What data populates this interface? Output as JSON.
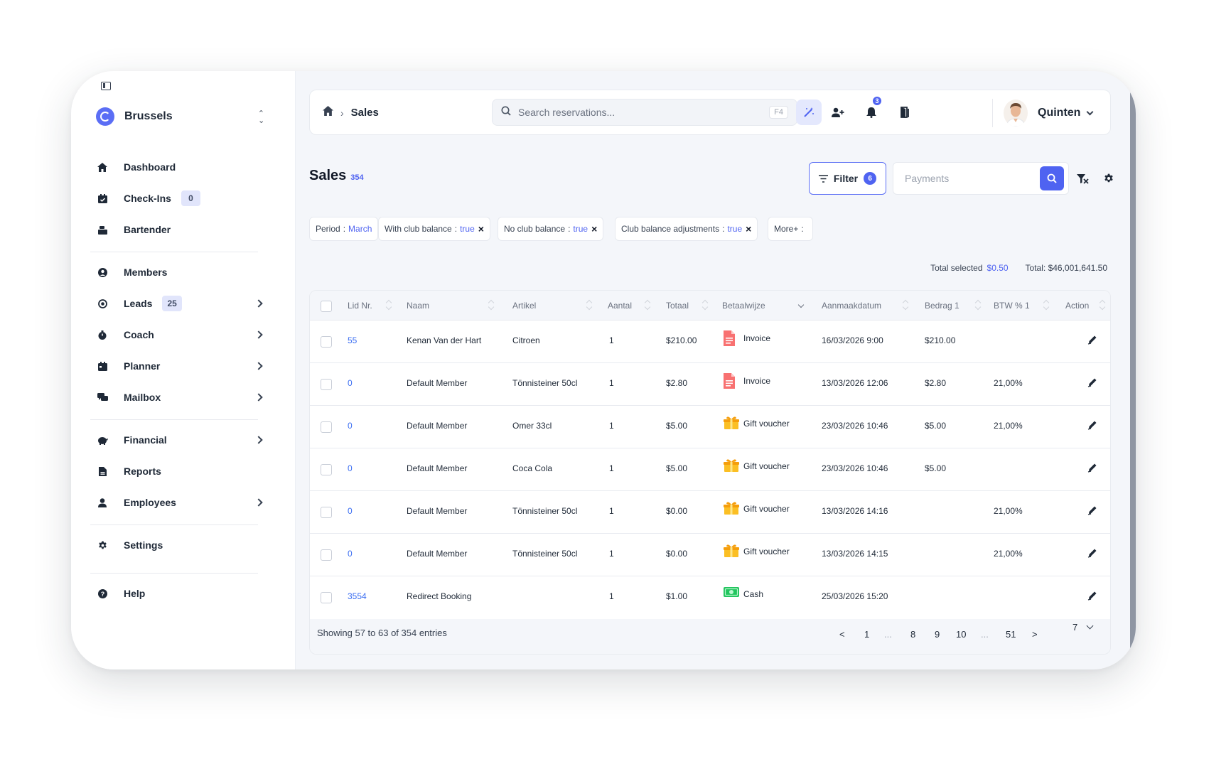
{
  "sidebar": {
    "club": "Brussels",
    "items": [
      {
        "label": "Dashboard",
        "icon": "home-icon"
      },
      {
        "label": "Check-Ins",
        "icon": "check-in-icon",
        "badge": "0"
      },
      {
        "label": "Bartender",
        "icon": "bartender-icon"
      },
      {
        "label": "Members",
        "icon": "user-circle-icon"
      },
      {
        "label": "Leads",
        "icon": "target-icon",
        "badge": "25"
      },
      {
        "label": "Coach",
        "icon": "stopwatch-icon"
      },
      {
        "label": "Planner",
        "icon": "calendar-icon"
      },
      {
        "label": "Mailbox",
        "icon": "chat-icon"
      },
      {
        "label": "Financial",
        "icon": "piggy-bank-icon"
      },
      {
        "label": "Reports",
        "icon": "document-icon"
      },
      {
        "label": "Employees",
        "icon": "user-icon"
      },
      {
        "label": "Settings",
        "icon": "gear-icon"
      },
      {
        "label": "Help",
        "icon": "help-icon"
      }
    ]
  },
  "header": {
    "breadcrumb_current": "Sales",
    "search_placeholder": "Search reservations...",
    "search_shortcut": "F4",
    "notification_count": "3",
    "user_name": "Quinten"
  },
  "page": {
    "title": "Sales",
    "count": "354",
    "filter_label": "Filter",
    "filter_count": "6",
    "payment_search_placeholder": "Payments"
  },
  "chips": [
    {
      "key": "Period",
      "value": "March"
    },
    {
      "key": "With club balance",
      "value": "true"
    },
    {
      "key": "No club balance",
      "value": "true"
    },
    {
      "key": "Club balance adjustments",
      "value": "true"
    },
    {
      "key": "More+",
      "value": ""
    }
  ],
  "totals": {
    "selected_label": "Total selected",
    "selected_value": "$0.50",
    "total_label": "Total:",
    "total_value": "$46,001,641.50"
  },
  "table": {
    "columns": [
      "Lid Nr.",
      "Naam",
      "Artikel",
      "Aantal",
      "Totaal",
      "Betaalwijze",
      "Aanmaakdatum",
      "Bedrag 1",
      "BTW % 1",
      "Action"
    ],
    "rows": [
      {
        "lid": "55",
        "naam": "Kenan Van der Hart",
        "artikel": "Citroen",
        "aantal": "1",
        "totaal": "$210.00",
        "betaalwijze": "Invoice",
        "pay_icon": "invoice-icon",
        "datum": "16/03/2026 9:00",
        "bedrag": "$210.00",
        "btw": ""
      },
      {
        "lid": "0",
        "naam": "Default Member",
        "artikel": "Tönnisteiner 50cl",
        "aantal": "1",
        "totaal": "$2.80",
        "betaalwijze": "Invoice",
        "pay_icon": "invoice-icon",
        "datum": "13/03/2026 12:06",
        "bedrag": "$2.80",
        "btw": "21,00%"
      },
      {
        "lid": "0",
        "naam": "Default Member",
        "artikel": "Omer 33cl",
        "aantal": "1",
        "totaal": "$5.00",
        "betaalwijze": "Gift voucher",
        "pay_icon": "gift-voucher-icon",
        "datum": "23/03/2026 10:46",
        "bedrag": "$5.00",
        "btw": "21,00%"
      },
      {
        "lid": "0",
        "naam": "Default Member",
        "artikel": "Coca Cola",
        "aantal": "1",
        "totaal": "$5.00",
        "betaalwijze": "Gift voucher",
        "pay_icon": "gift-voucher-icon",
        "datum": "23/03/2026 10:46",
        "bedrag": "$5.00",
        "btw": ""
      },
      {
        "lid": "0",
        "naam": "Default Member",
        "artikel": "Tönnisteiner 50cl",
        "aantal": "1",
        "totaal": "$0.00",
        "betaalwijze": "Gift voucher",
        "pay_icon": "gift-voucher-icon",
        "datum": "13/03/2026 14:16",
        "bedrag": "",
        "btw": "21,00%"
      },
      {
        "lid": "0",
        "naam": "Default Member",
        "artikel": "Tönnisteiner 50cl",
        "aantal": "1",
        "totaal": "$0.00",
        "betaalwijze": "Gift voucher",
        "pay_icon": "gift-voucher-icon",
        "datum": "13/03/2026 14:15",
        "bedrag": "",
        "btw": "21,00%"
      },
      {
        "lid": "3554",
        "naam": "Redirect Booking",
        "artikel": "",
        "aantal": "1",
        "totaal": "$1.00",
        "betaalwijze": "Cash",
        "pay_icon": "cash-icon",
        "datum": "25/03/2026 15:20",
        "bedrag": "",
        "btw": ""
      }
    ]
  },
  "footer": {
    "showing": "Showing 57 to 63 of 354 entries",
    "pagination": [
      "<",
      "1",
      "...",
      "8",
      "9",
      "10",
      "...",
      "51",
      ">"
    ],
    "per_page": "7"
  },
  "colors": {
    "accent": "#4f63f1",
    "link": "#3b6ef2",
    "background": "#f4f6fa"
  }
}
